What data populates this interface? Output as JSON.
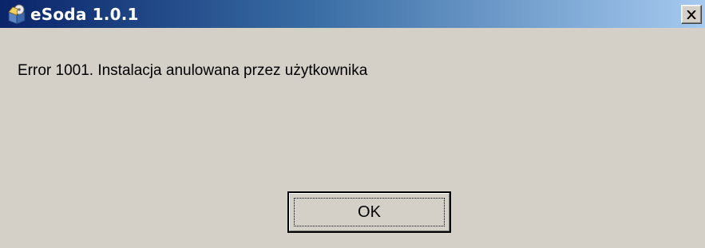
{
  "window": {
    "title": "eSoda 1.0.1",
    "icon": "installer-package-icon",
    "close_icon": "close-icon"
  },
  "dialog": {
    "message": "Error 1001. Instalacja anulowana przez użytkownika",
    "ok_label": "OK"
  },
  "colors": {
    "titlebar_start": "#0a246a",
    "titlebar_end": "#a6caf0",
    "dialog_background": "#d4d0c8",
    "title_text": "#ffffff"
  }
}
